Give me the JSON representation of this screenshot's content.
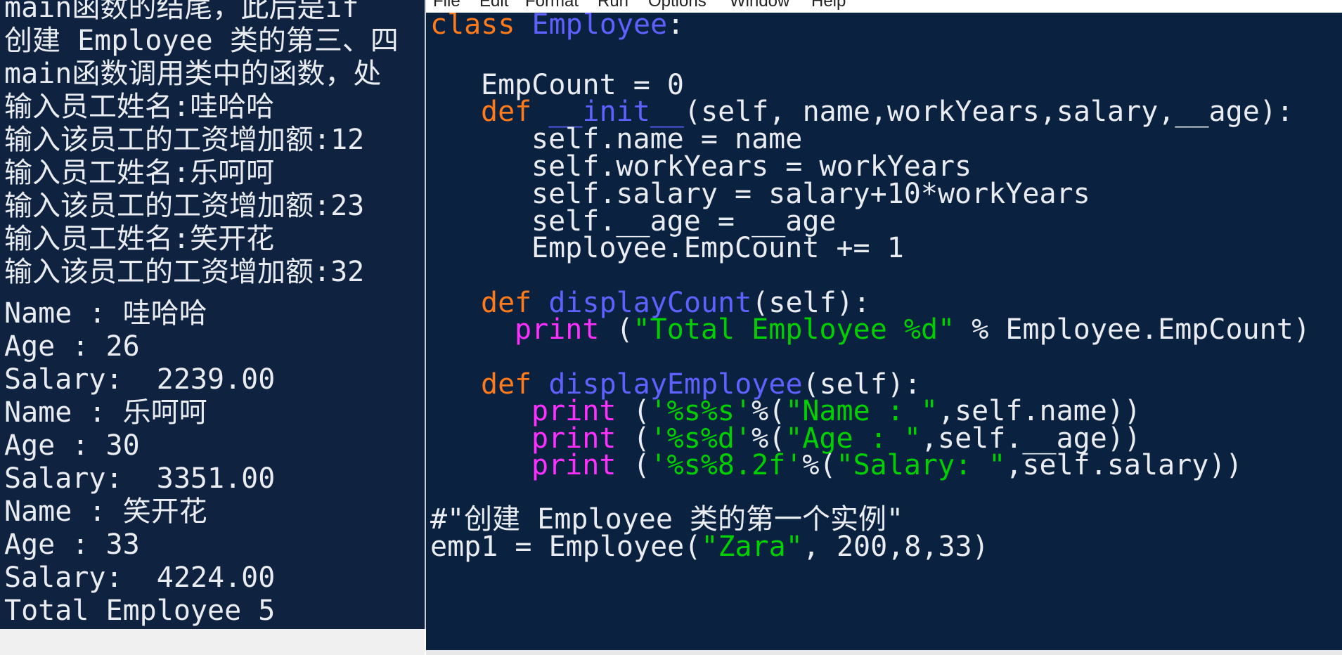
{
  "shell": {
    "lines": [
      "main函数的结尾，此后是if",
      "创建 Employee 类的第三、四",
      "main函数调用类中的函数，处",
      "输入员工姓名:哇哈哈",
      "输入该员工的工资增加额:12",
      "输入员工姓名:乐呵呵",
      "输入该员工的工资增加额:23",
      "输入员工姓名:笑开花",
      "输入该员工的工资增加额:32",
      "Name : 哇哈哈",
      "Age : 26",
      "Salary:  2239.00",
      "Name : 乐呵呵",
      "Age : 30",
      "Salary:  3351.00",
      "Name : 笑开花",
      "Age : 33",
      "Salary:  4224.00",
      "Total Employee 5"
    ]
  },
  "editor": {
    "menu": [
      "File",
      "Edit",
      "Format",
      "Run",
      "Options",
      "Window",
      "Help"
    ],
    "code": {
      "l1_kw": "class",
      "l1_name": "Employee",
      "l1_colon": ":",
      "l2": "EmpCount = 0",
      "l3_kw": "def",
      "l3_fn": "__init__",
      "l3_rest": "(self, name,workYears,salary,__age):",
      "l4": "self.name = name",
      "l5": "self.workYears = workYears",
      "l6": "self.salary = salary+10*workYears",
      "l7": "self.__age = __age",
      "l8": "Employee.EmpCount += 1",
      "l9_kw": "def",
      "l9_fn": "displayCount",
      "l9_rest": "(self):",
      "l10_bi": "print",
      "l10_a": " (",
      "l10_str": "\"Total Employee %d\"",
      "l10_b": " % Employee.EmpCount)",
      "l11_kw": "def",
      "l11_fn": "displayEmployee",
      "l11_rest": "(self):",
      "l12_bi": "print",
      "l12_a": " (",
      "l12_s1": "'%s%s'",
      "l12_b": "%(",
      "l12_s2": "\"Name : \"",
      "l12_c": ",self.name))",
      "l13_bi": "print",
      "l13_a": " (",
      "l13_s1": "'%s%d'",
      "l13_b": "%(",
      "l13_s2": "\"Age : \"",
      "l13_c": ",self.__age))",
      "l14_bi": "print",
      "l14_a": " (",
      "l14_s1": "'%s%8.2f'",
      "l14_b": "%(",
      "l14_s2": "\"Salary: \"",
      "l14_c": ",self.salary))",
      "l15_comment": "#\"创建 Employee 类的第一个实例\"",
      "l16_a": "emp1 = Employee(",
      "l16_str": "\"Zara\"",
      "l16_b": ", 200,8,33)"
    }
  },
  "colors": {
    "shell_bg": "#0f2340",
    "editor_bg": "#0a2140",
    "keyword": "#ff7a1a",
    "definition": "#6060ff",
    "builtin": "#ff30ff",
    "string": "#00d000",
    "comment": "#ff2020",
    "text": "#e9edf2"
  }
}
